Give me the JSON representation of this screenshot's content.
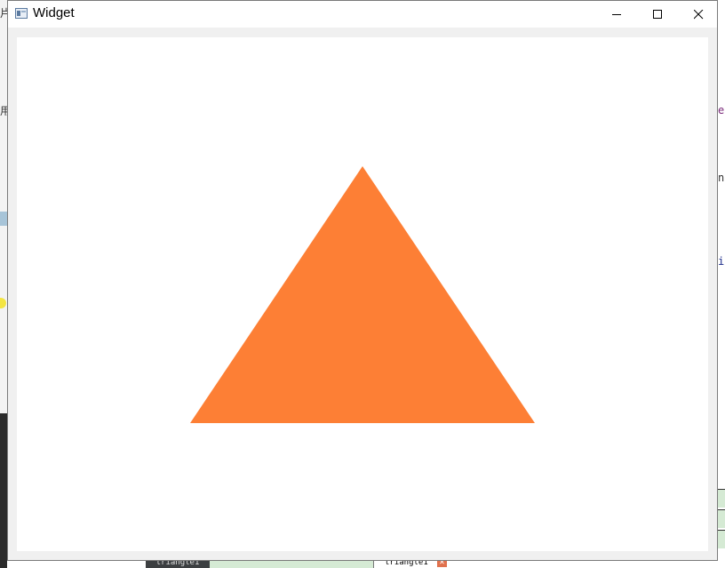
{
  "window": {
    "title": "Widget",
    "controls": {
      "minimize_icon": "minimize-icon",
      "maximize_icon": "maximize-icon",
      "close_icon": "close-icon"
    }
  },
  "canvas": {
    "background": "#ffffff",
    "shape": {
      "type": "triangle",
      "fill": "#fd7f35"
    }
  },
  "background_app": {
    "fragments": [
      "片",
      "用",
      "e",
      "n",
      "i"
    ],
    "bottom_tabs": [
      "triangle1",
      "triangle1"
    ],
    "tab_close_icon": "close-icon"
  }
}
